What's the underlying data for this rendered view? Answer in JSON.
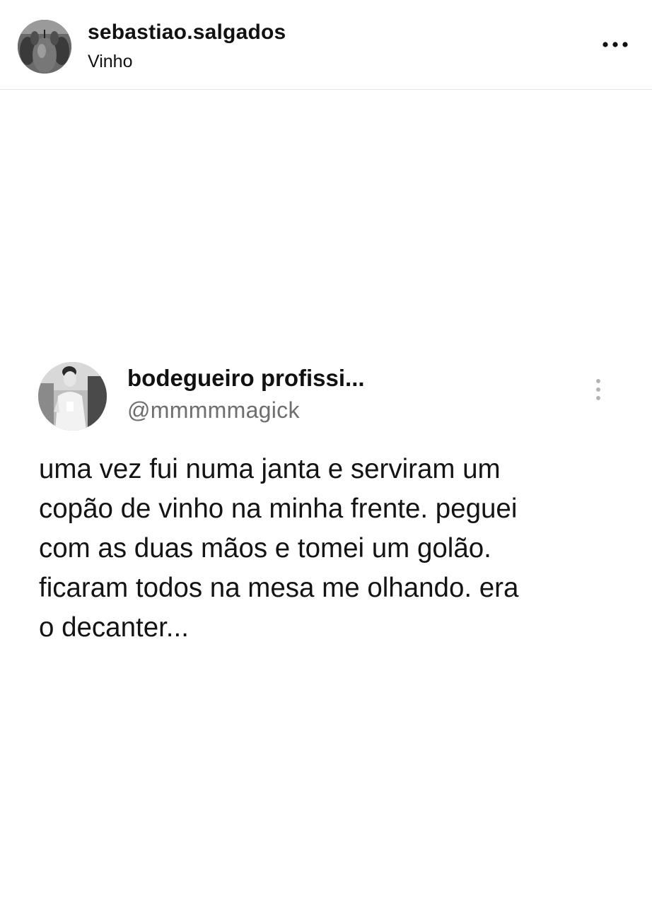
{
  "post": {
    "username": "sebastiao.salgados",
    "subtitle": "Vinho",
    "avatar_icon": "profile-avatar-pears",
    "more_icon": "more-horizontal-icon"
  },
  "tweet": {
    "display_name": "bodegueiro profissi...",
    "handle": "@mmmmmagick",
    "avatar_icon": "profile-avatar-person",
    "options_icon": "more-vertical-icon",
    "text_lines": [
      "uma vez fui numa janta e serviram um",
      "copão de vinho na minha frente. peguei",
      "com as duas mãos e tomei um golão.",
      "ficaram todos na mesa me olhando. era",
      "o decanter..."
    ]
  },
  "colors": {
    "background": "#ffffff",
    "text_primary": "#111111",
    "text_secondary": "#6e6e6e",
    "divider": "#e6e6e6"
  }
}
